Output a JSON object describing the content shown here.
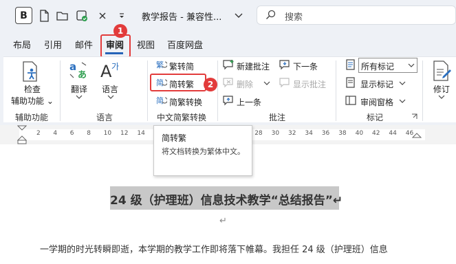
{
  "titlebar": {
    "bold_label": "B",
    "doc_title": "教学报告 - 兼容性...",
    "search_placeholder": "搜索"
  },
  "tabs": [
    {
      "label": "布局"
    },
    {
      "label": "引用"
    },
    {
      "label": "邮件"
    },
    {
      "label": "审阅"
    },
    {
      "label": "视图"
    },
    {
      "label": "百度网盘"
    }
  ],
  "ribbon": {
    "proofing": {
      "check_label": "检查",
      "assist_label": "辅助功能 ⌄",
      "group_label": "辅助功能"
    },
    "language": {
      "translate_label": "翻译",
      "language_label": "语言",
      "group_label": "语言"
    },
    "chinese": {
      "trad_to_simp": "繁转简",
      "simp_to_trad": "简转繁",
      "simp_trad_convert": "简繁转换",
      "group_label": "中文简繁转换"
    },
    "comments": {
      "new_comment": "新建批注",
      "delete": "删除",
      "prev": "上一条",
      "next": "下一条",
      "show_comments": "显示批注",
      "group_label": "批注"
    },
    "tracking": {
      "markup_select": "所有标记",
      "show_markup": "显示标记",
      "review_pane": "审阅窗格",
      "group_label": "标记"
    },
    "revisions": {
      "label": "修订"
    }
  },
  "callouts": [
    {
      "label": "1"
    },
    {
      "label": "2"
    }
  ],
  "ruler_ticks": [
    "2",
    "4",
    "6",
    "8",
    "10",
    "12",
    "14",
    "16",
    "18",
    "20",
    "22",
    "24",
    "26",
    "28",
    "30",
    "32",
    "34",
    "36",
    "38",
    "40",
    "42",
    "44",
    "46"
  ],
  "tooltip": {
    "title": "简转繁",
    "description": "将文档转换为繁体中文。"
  },
  "document": {
    "title": "24 级（护理班）信息技术教学“总结报告”↵",
    "empty_paragraph_mark": "↵",
    "first_line": "一学期的时光转瞬即逝，本学期的教学工作即将落下帷幕。我担任 24 级（护理班）信息"
  }
}
